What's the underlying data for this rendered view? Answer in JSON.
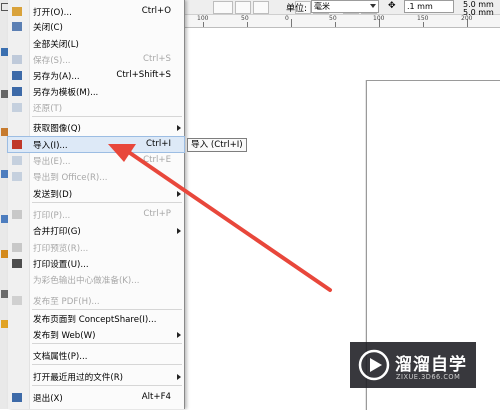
{
  "colors": {
    "menu_bg": "#fbfbfb",
    "highlight": "#dde9f7",
    "disabled_text": "#a8a8a8",
    "annotation_arrow": "#e8473b",
    "watermark_bg": "#1c1c22"
  },
  "property_bar": {
    "unit_label": "单位:",
    "unit_value": "毫米",
    "nudge_value": ".1 mm",
    "dup_x": "5.0 mm",
    "dup_y": "5.0 mm"
  },
  "menu": {
    "items": [
      {
        "label": "打开(O)...",
        "shortcut": "Ctrl+O",
        "icon": "open-folder-icon",
        "disabled": false,
        "submenu": false
      },
      {
        "label": "关闭(C)",
        "shortcut": "",
        "icon": "close-doc-icon",
        "disabled": false,
        "submenu": false
      },
      {
        "label": "全部关闭(L)",
        "shortcut": "",
        "icon": "",
        "disabled": false,
        "submenu": false
      },
      {
        "label": "保存(S)...",
        "shortcut": "Ctrl+S",
        "icon": "save-icon",
        "disabled": true,
        "submenu": false
      },
      {
        "label": "另存为(A)...",
        "shortcut": "Ctrl+Shift+S",
        "icon": "save-as-icon",
        "disabled": false,
        "submenu": false
      },
      {
        "label": "另存为模板(M)...",
        "shortcut": "",
        "icon": "template-icon",
        "disabled": false,
        "submenu": false
      },
      {
        "label": "还原(T)",
        "shortcut": "",
        "icon": "revert-icon",
        "disabled": true,
        "submenu": false
      },
      {
        "label": "获取图像(Q)",
        "shortcut": "",
        "icon": "",
        "disabled": false,
        "submenu": true
      },
      {
        "label": "导入(I)...",
        "shortcut": "Ctrl+I",
        "icon": "import-icon",
        "disabled": false,
        "submenu": false,
        "highlighted": true
      },
      {
        "label": "导出(E)...",
        "shortcut": "Ctrl+E",
        "icon": "export-icon",
        "disabled": true,
        "submenu": false
      },
      {
        "label": "导出到 Office(R)...",
        "shortcut": "",
        "icon": "export-office-icon",
        "disabled": true,
        "submenu": false
      },
      {
        "label": "发送到(D)",
        "shortcut": "",
        "icon": "",
        "disabled": false,
        "submenu": true
      },
      {
        "label": "打印(P)...",
        "shortcut": "Ctrl+P",
        "icon": "print-icon",
        "disabled": true,
        "submenu": false
      },
      {
        "label": "合并打印(G)",
        "shortcut": "",
        "icon": "",
        "disabled": false,
        "submenu": true
      },
      {
        "label": "打印预览(R)...",
        "shortcut": "",
        "icon": "print-preview-icon",
        "disabled": true,
        "submenu": false
      },
      {
        "label": "打印设置(U)...",
        "shortcut": "",
        "icon": "print-setup-icon",
        "disabled": false,
        "submenu": false
      },
      {
        "label": "为彩色输出中心做准备(K)...",
        "shortcut": "",
        "icon": "",
        "disabled": true,
        "submenu": false
      },
      {
        "label": "发布至 PDF(H)...",
        "shortcut": "",
        "icon": "pdf-icon",
        "disabled": true,
        "submenu": false
      },
      {
        "label": "发布页面到 ConceptShare(I)...",
        "shortcut": "",
        "icon": "",
        "disabled": false,
        "submenu": false
      },
      {
        "label": "发布到 Web(W)",
        "shortcut": "",
        "icon": "",
        "disabled": false,
        "submenu": true
      },
      {
        "label": "文档属性(P)...",
        "shortcut": "",
        "icon": "",
        "disabled": false,
        "submenu": false
      },
      {
        "label": "打开最近用过的文件(R)",
        "shortcut": "",
        "icon": "",
        "disabled": false,
        "submenu": true
      },
      {
        "label": "退出(X)",
        "shortcut": "Alt+F4",
        "icon": "exit-icon",
        "disabled": false,
        "submenu": false
      }
    ]
  },
  "tooltip": "导入 (Ctrl+I)",
  "ruler_labels": [
    "100",
    "50",
    "0",
    "50",
    "100",
    "150",
    "200"
  ],
  "watermark": {
    "brand": "溜溜自学",
    "url": "ZIXUE.3D66.COM"
  }
}
